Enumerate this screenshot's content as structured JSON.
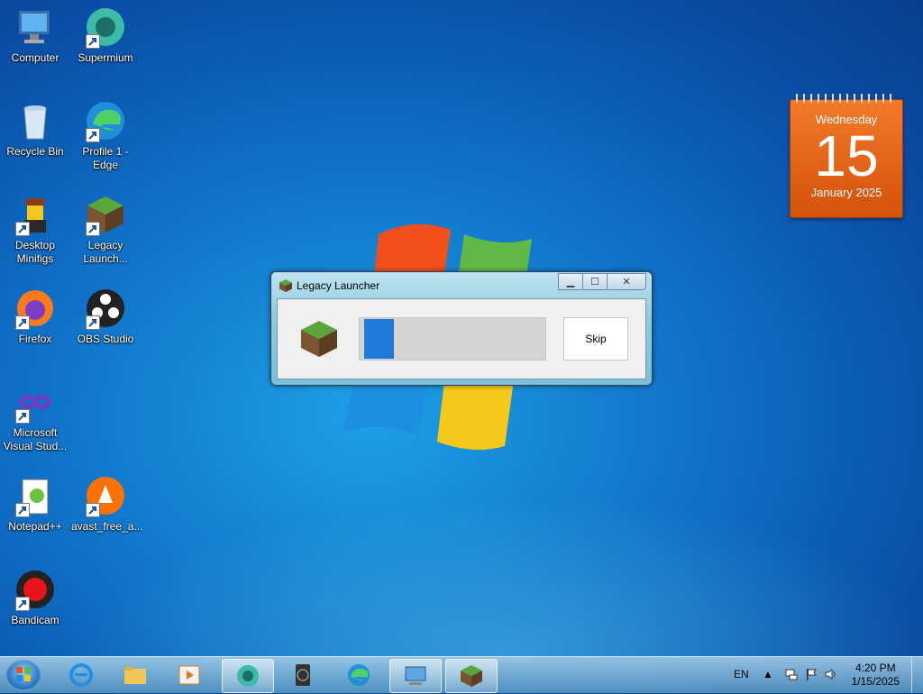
{
  "desktop_icons": [
    {
      "label": "Computer",
      "icon": "computer-icon"
    },
    {
      "label": "Supermium",
      "icon": "supermium-icon"
    },
    {
      "label": "Recycle Bin",
      "icon": "recycle-bin-icon"
    },
    {
      "label": "Profile 1 - Edge",
      "icon": "edge-icon"
    },
    {
      "label": "Desktop Minifigs",
      "icon": "minifig-icon"
    },
    {
      "label": "Legacy Launch...",
      "icon": "grass-block-icon"
    },
    {
      "label": "Firefox",
      "icon": "firefox-icon"
    },
    {
      "label": "OBS Studio",
      "icon": "obs-icon"
    },
    {
      "label": "Microsoft Visual Stud...",
      "icon": "visual-studio-icon"
    },
    {
      "label": "Notepad++",
      "icon": "notepadpp-icon"
    },
    {
      "label": "avast_free_a...",
      "icon": "avast-icon"
    },
    {
      "label": "Bandicam",
      "icon": "bandicam-icon"
    }
  ],
  "calendar": {
    "weekday": "Wednesday",
    "day": "15",
    "month_year": "January 2025"
  },
  "dialog": {
    "title": "Legacy Launcher",
    "progress": 0.17,
    "skip_label": "Skip",
    "progress_color": "#1f7bd9"
  },
  "taskbar": {
    "items": [
      "start-orb",
      "internet-explorer",
      "file-explorer",
      "media-player",
      "supermium",
      "wiiu-sd",
      "edge",
      "remote-desktop",
      "legacy-launcher"
    ],
    "language": "EN",
    "time": "4:20 PM",
    "date": "1/15/2025"
  }
}
